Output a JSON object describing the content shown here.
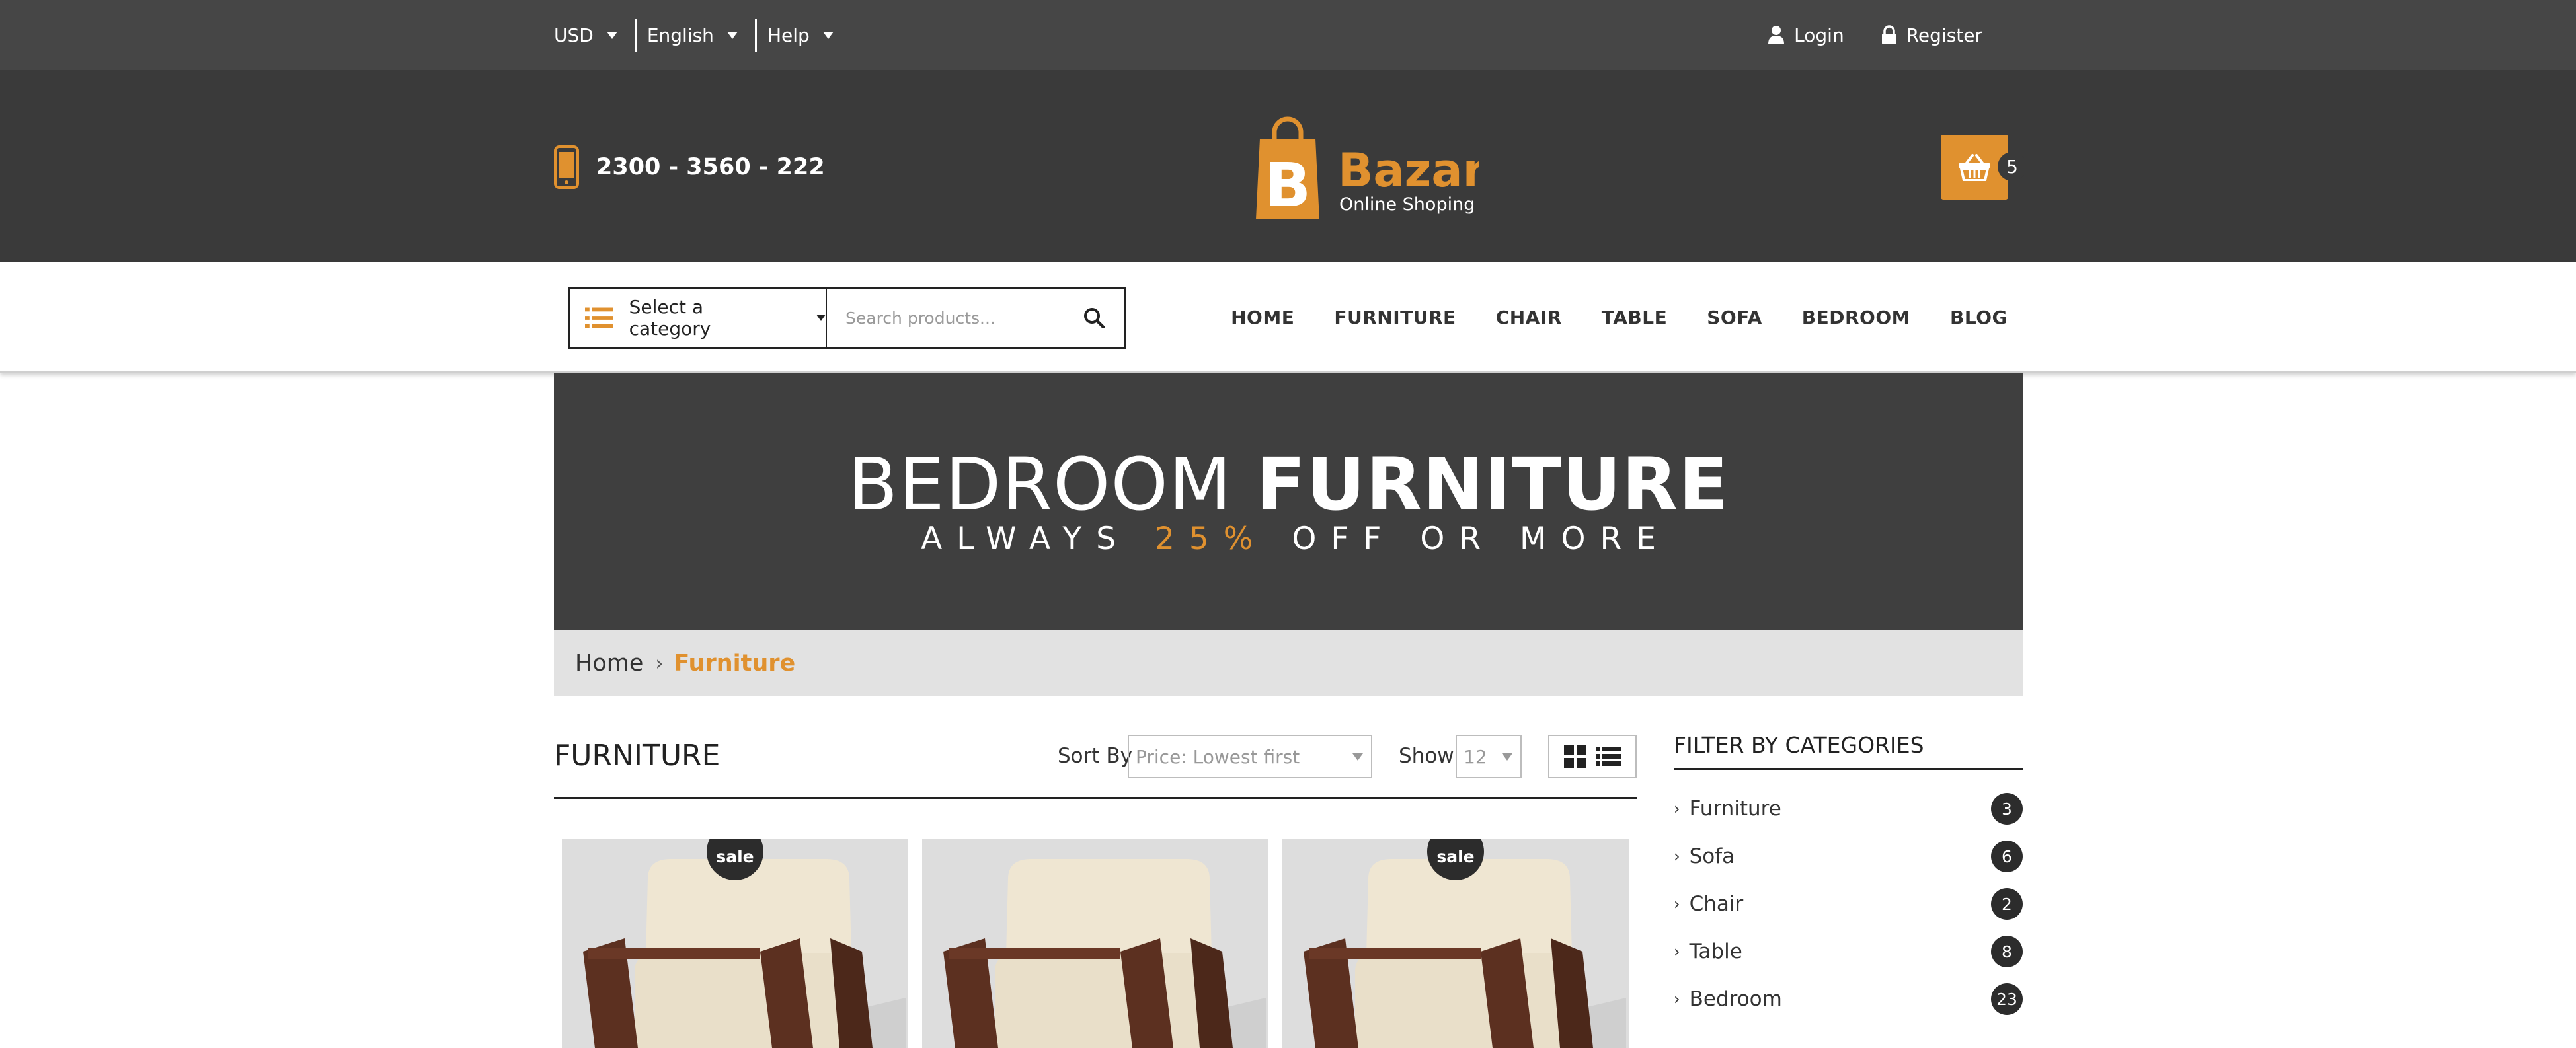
{
  "topbar": {
    "currency": "USD",
    "language": "English",
    "help": "Help",
    "login": "Login",
    "register": "Register"
  },
  "header": {
    "phone": "2300 - 3560 - 222",
    "logo": {
      "name": "Bazar",
      "tagline": "Online Shoping",
      "letter": "B"
    },
    "cart_count": "5"
  },
  "search": {
    "category": "Select a category",
    "placeholder": "Search products..."
  },
  "menu": [
    "HOME",
    "FURNITURE",
    "CHAIR",
    "TABLE",
    "SOFA",
    "BEDROOM",
    "BLOG"
  ],
  "banner": {
    "title_light": "BEDROOM",
    "title_bold": "FURNITURE",
    "sub_before": "ALWAYS ",
    "sub_accent": "25%",
    "sub_after": " OFF OR MORE"
  },
  "breadcrumb": {
    "home": "Home",
    "separator": "›",
    "current": "Furniture"
  },
  "listing": {
    "title": "FURNITURE",
    "sort_label": "Sort By",
    "sort_value": "Price: Lowest first",
    "show_label": "Show",
    "show_value": "12"
  },
  "products": [
    {
      "badge": "sale"
    },
    {
      "badge": ""
    },
    {
      "badge": "sale"
    }
  ],
  "sidebar": {
    "title": "FILTER BY CATEGORIES",
    "categories": [
      {
        "label": "Furniture",
        "count": "3"
      },
      {
        "label": "Sofa",
        "count": "6"
      },
      {
        "label": "Chair",
        "count": "2"
      },
      {
        "label": "Table",
        "count": "8"
      },
      {
        "label": "Bedroom",
        "count": "23"
      }
    ]
  },
  "colors": {
    "accent": "#e0912f",
    "topbar": "#464646",
    "header": "#3a3a3a",
    "banner": "#3f3f3f",
    "crumbs": "#e2e2e2"
  },
  "icons": [
    "user-icon",
    "lock-icon",
    "phone-icon",
    "basket-icon",
    "list-icon",
    "search-icon",
    "grid-view-icon",
    "list-view-icon",
    "chevron-right-icon"
  ]
}
